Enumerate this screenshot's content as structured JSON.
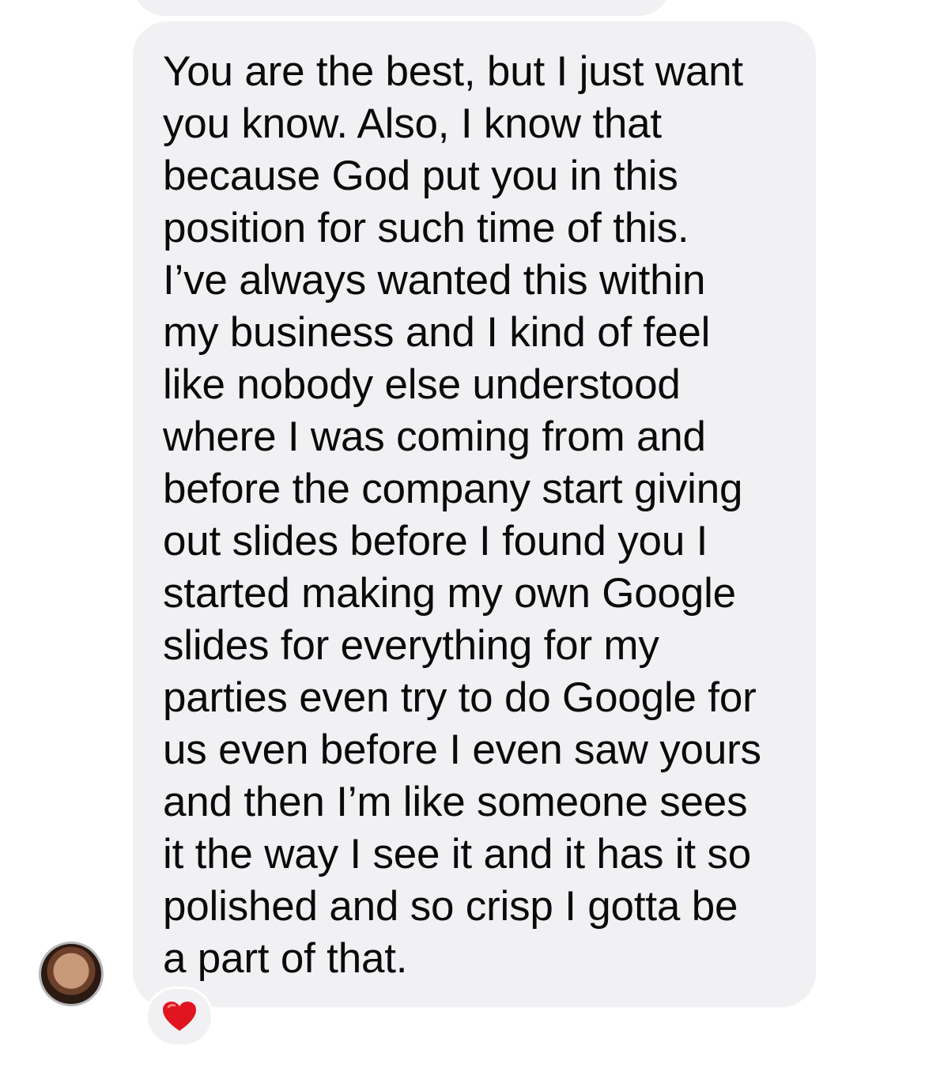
{
  "conversation": {
    "message": {
      "lines": [
        "You are the best, but I just want",
        "you know. Also, I know that",
        "because God put you in this",
        "position for such time of this.",
        "I’ve always wanted this within",
        "my business and I kind of feel",
        "like nobody else understood",
        "where I was coming from and",
        "before the company start giving",
        "out slides before I found you I",
        "started making my own Google",
        "slides for everything for my",
        "parties even try to do Google for",
        "us even before I even saw yours",
        "and then I’m like someone sees",
        "it the way I see it and it has it so",
        "polished and so crisp I gotta be",
        "a part of that."
      ],
      "reaction": {
        "icon": "heart-icon",
        "color": "#e0151f"
      }
    },
    "sender_avatar": {
      "icon": "avatar"
    },
    "bubble_color": "#f1f1f4"
  }
}
